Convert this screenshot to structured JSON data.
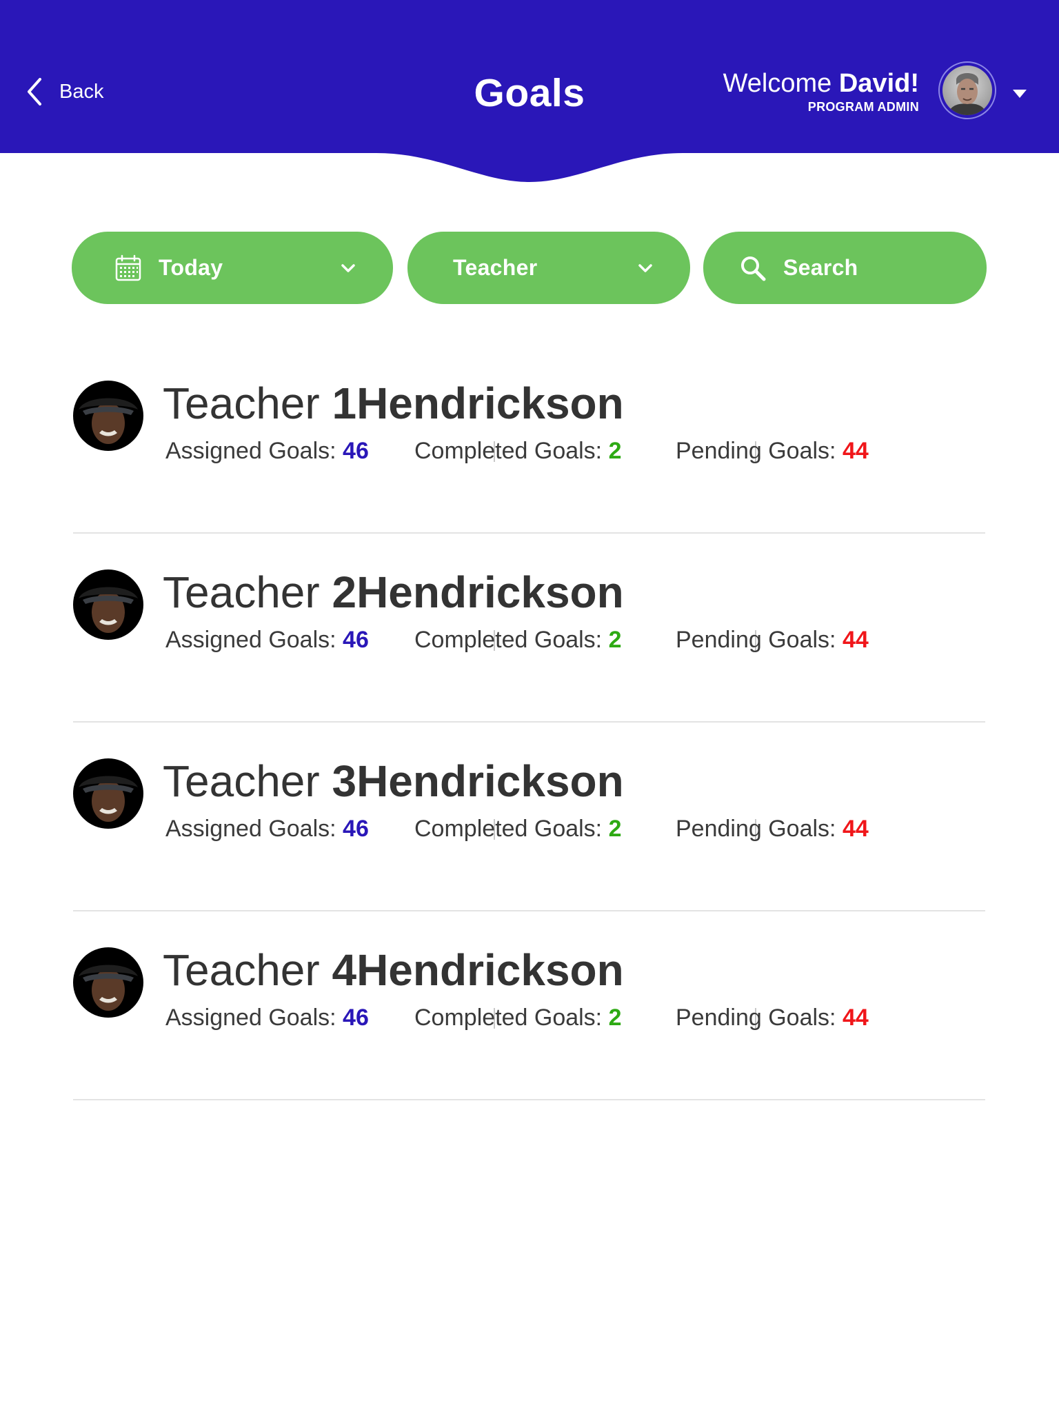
{
  "colors": {
    "header_bg": "#2A17B8",
    "filter_bg": "#6CC45C",
    "assigned_value": "#2A17B8",
    "completed_value": "#2EAA14",
    "pending_value": "#F0161A"
  },
  "header": {
    "back_label": "Back",
    "back_icon": "chevron-left-icon",
    "title": "Goals",
    "welcome_prefix": "Welcome",
    "welcome_name": "David!",
    "role": "PROGRAM ADMIN",
    "profile_caret_icon": "caret-down-icon"
  },
  "filters": {
    "date": {
      "label": "Today",
      "icon": "calendar-icon",
      "dropdown_icon": "chevron-down-icon"
    },
    "role": {
      "label": "Teacher",
      "dropdown_icon": "chevron-down-icon"
    },
    "search": {
      "label": "Search",
      "icon": "search-icon"
    }
  },
  "teachers": [
    {
      "name_prefix": "Teacher",
      "name_main": "1Hendrickson",
      "assigned_label": "Assigned Goals: ",
      "assigned_value": "46",
      "completed_label": "Completed Goals: ",
      "completed_value": "2",
      "pending_label": "Pending Goals: ",
      "pending_value": "44"
    },
    {
      "name_prefix": "Teacher",
      "name_main": "2Hendrickson",
      "assigned_label": "Assigned Goals: ",
      "assigned_value": "46",
      "completed_label": "Completed Goals: ",
      "completed_value": "2",
      "pending_label": "Pending Goals: ",
      "pending_value": "44"
    },
    {
      "name_prefix": "Teacher",
      "name_main": "3Hendrickson",
      "assigned_label": "Assigned Goals: ",
      "assigned_value": "46",
      "completed_label": "Completed Goals: ",
      "completed_value": "2",
      "pending_label": "Pending Goals: ",
      "pending_value": "44"
    },
    {
      "name_prefix": "Teacher",
      "name_main": "4Hendrickson",
      "assigned_label": "Assigned Goals: ",
      "assigned_value": "46",
      "completed_label": "Completed Goals: ",
      "completed_value": "2",
      "pending_label": "Pending Goals: ",
      "pending_value": "44"
    }
  ]
}
